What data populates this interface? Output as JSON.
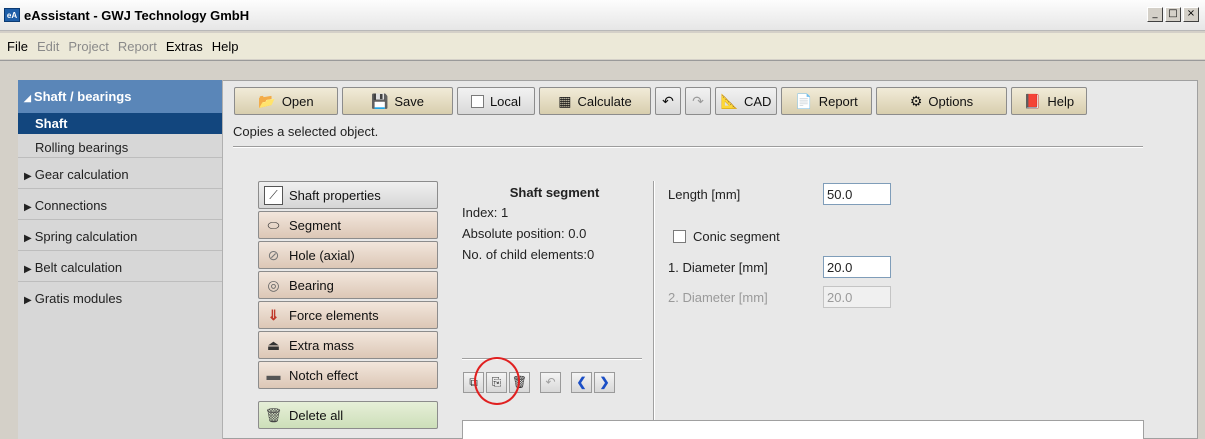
{
  "window": {
    "title": "eAssistant - GWJ Technology GmbH",
    "icon_text": "eA"
  },
  "menubar": [
    {
      "label": "File",
      "enabled": true
    },
    {
      "label": "Edit",
      "enabled": false
    },
    {
      "label": "Project",
      "enabled": false
    },
    {
      "label": "Report",
      "enabled": false
    },
    {
      "label": "Extras",
      "enabled": true
    },
    {
      "label": "Help",
      "enabled": true
    }
  ],
  "sidebar": {
    "header": "Shaft / bearings",
    "active_item": "Shaft",
    "sub_item": "Rolling bearings",
    "groups": [
      "Gear calculation",
      "Connections",
      "Spring calculation",
      "Belt calculation",
      "Gratis modules"
    ]
  },
  "toolbar": {
    "open": "Open",
    "save": "Save",
    "local": "Local",
    "calculate": "Calculate",
    "cad": "CAD",
    "report": "Report",
    "options": "Options",
    "help": "Help"
  },
  "status": "Copies a selected object.",
  "elements": {
    "shaft_properties": "Shaft properties",
    "segment": "Segment",
    "hole_axial": "Hole (axial)",
    "bearing": "Bearing",
    "force_elements": "Force elements",
    "extra_mass": "Extra mass",
    "notch_effect": "Notch effect",
    "delete_all": "Delete all"
  },
  "segment_info": {
    "title": "Shaft segment",
    "index": "Index: 1",
    "absolute_position": "Absolute position:  0.0",
    "child_elements": "No. of child elements:0"
  },
  "properties": {
    "length_label": "Length [mm]",
    "length_value": "50.0",
    "conic_label": "Conic segment",
    "diameter1_label": "1. Diameter [mm]",
    "diameter1_value": "20.0",
    "diameter2_label": "2. Diameter [mm]",
    "diameter2_value": "20.0"
  },
  "colors": {
    "sidebar_header": "#5a86b8",
    "sidebar_active": "#12467e",
    "highlight_circle": "#e02020"
  }
}
